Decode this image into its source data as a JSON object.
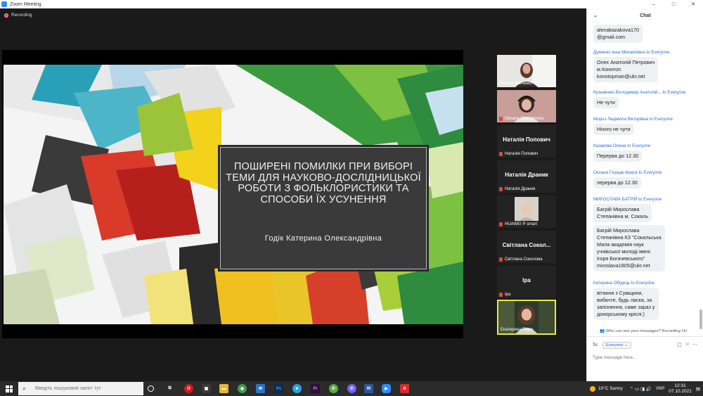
{
  "window": {
    "title": "Zoom Meeting",
    "controls": [
      "–",
      "□",
      "✕"
    ]
  },
  "recording": {
    "label": "Recording"
  },
  "slide": {
    "title": "ПОШИРЕНІ ПОМИЛКИ ПРИ ВИБОРІ ТЕМИ ДЛЯ НАУКОВО-ДОСЛІДНИЦЬКОЇ РОБОТИ З ФОЛЬКЛОРИСТИКИ ТА СПОСОБИ ЇХ УСУНЕННЯ",
    "author": "Годік Катерина Олександрівна"
  },
  "participants": [
    {
      "name": "Оксана Хімченко",
      "video": true,
      "muted": false,
      "tone": "#8a6a5e"
    },
    {
      "name": "Oksana Gavrylevska",
      "video": true,
      "muted": true,
      "tone": "#b98b87"
    },
    {
      "name": "Наталія Попович",
      "display": "Наталія Попович",
      "video": false,
      "muted": true
    },
    {
      "name": "Наталія Драник",
      "display": "Наталія Драник",
      "video": false,
      "muted": true
    },
    {
      "name": "HUAWEI P smart",
      "video": true,
      "muted": true,
      "tone": "#c9c4bd"
    },
    {
      "name": "Світлана Соколова",
      "display": "Світлана Сокол...",
      "video": false,
      "muted": true
    },
    {
      "name": "Іра",
      "display": "Іра",
      "video": false,
      "muted": true
    },
    {
      "name": "Екатерина Годик",
      "video": true,
      "muted": false,
      "active": true,
      "tone": "#7a5a48"
    }
  ],
  "chat": {
    "title": "Chat",
    "to_word": "to",
    "messages": [
      {
        "sender": "",
        "lines": [
          "alenakazakova170",
          "@gmail.com"
        ]
      },
      {
        "sender": "Думенко Інна Михайлівна",
        "recipient": "Everyone",
        "lines": [
          "Олех Анатолій Петрович",
          "м.Конотоп",
          "konotopman@ukr.net"
        ]
      },
      {
        "sender": "Кузьменко Володимир Анатолій...",
        "recipient": "Everyone",
        "lines": [
          "Не чути"
        ]
      },
      {
        "sender": "Мороз Людмила Вікторівна",
        "recipient": "Everyone",
        "lines": [
          "Нічого не чути"
        ]
      },
      {
        "sender": "Казакова Олена",
        "recipient": "Everyone",
        "lines": [
          "Перерва до 12.30"
        ]
      },
      {
        "sender": "Оксана Глущак-Криса",
        "recipient": "Everyone",
        "lines": [
          "перерва до 12.30"
        ]
      },
      {
        "sender": "МИРОСЛАВА БАГРІЙ",
        "recipient": "Everyone",
        "lines": [
          "Багрій Мирослава",
          "Степанівна м. Сокаль"
        ]
      },
      {
        "sender": "",
        "lines": [
          "Багрій Мирослава",
          "Степанівна КЗ \"Сокальська",
          "Мала академія наук",
          "учнівської молоді імені",
          "Ігоря Богачевського\"",
          "miroslava1805@ukr.net"
        ]
      },
      {
        "sender": "Катерина Обідець",
        "recipient": "Everyone",
        "lines": [
          "вітання з Сумщини,",
          "вибачте,  будь ласка,  за",
          "запізнення,  саме зараз у",
          "донорському кріслі:)"
        ]
      }
    ],
    "visibility_note": "Who can see your messages? Recording On",
    "to_label": "To:",
    "to_value": "Everyone",
    "input_placeholder": "Type message here..."
  },
  "taskbar": {
    "search_placeholder": "Введіть пошуковий запит тут",
    "apps": [
      {
        "icon": "task-view-icon",
        "label": "⧉",
        "color": "transparent"
      },
      {
        "icon": "opera-icon",
        "label": "O",
        "color": "#d21a1a"
      },
      {
        "icon": "store-icon",
        "label": "▣",
        "color": "#3a3a3a"
      },
      {
        "icon": "folder-icon",
        "label": "▬",
        "color": "#e8b53c"
      },
      {
        "icon": "chrome-icon",
        "label": "◉",
        "color": "#3c9e45"
      },
      {
        "icon": "mail-icon",
        "label": "✉",
        "color": "#2a75c8"
      },
      {
        "icon": "photoshop-icon",
        "label": "Ps",
        "color": "#0f2a4a"
      },
      {
        "icon": "telegram-icon",
        "label": "➤",
        "color": "#2aa3dc"
      },
      {
        "icon": "premiere-icon",
        "label": "Pr",
        "color": "#2a0f3a"
      },
      {
        "icon": "viber-green-icon",
        "label": "✆",
        "color": "#5aa845"
      },
      {
        "icon": "viber-icon",
        "label": "✆",
        "color": "#7360f2"
      },
      {
        "icon": "word-icon",
        "label": "W",
        "color": "#2b579a"
      },
      {
        "icon": "zoom-icon",
        "label": "▶",
        "color": "#2d8cff"
      },
      {
        "icon": "acrobat-icon",
        "label": "A",
        "color": "#d92b2b"
      }
    ],
    "weather": "10°C  Sunny",
    "tray_icons": "⌃ ▭ ◨ ◀) УКР",
    "language": "УКР",
    "time": "12:31",
    "date": "07.10.2021"
  }
}
